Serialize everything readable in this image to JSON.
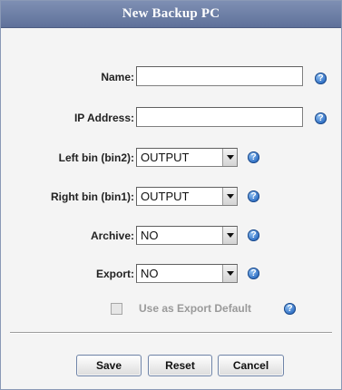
{
  "dialog": {
    "title": "New Backup PC"
  },
  "form": {
    "name": {
      "label": "Name:",
      "value": ""
    },
    "ip_address": {
      "label": "IP Address:",
      "value": ""
    },
    "left_bin": {
      "label": "Left bin (bin2):",
      "value": "OUTPUT"
    },
    "right_bin": {
      "label": "Right bin (bin1):",
      "value": "OUTPUT"
    },
    "archive": {
      "label": "Archive:",
      "value": "NO"
    },
    "export": {
      "label": "Export:",
      "value": "NO"
    },
    "export_default": {
      "label": "Use as Export Default",
      "checked": false,
      "disabled": true
    }
  },
  "help_glyph": "?",
  "icons": {
    "help": "help-icon",
    "dropdown": "chevron-down-icon"
  },
  "buttons": {
    "save": "Save",
    "reset": "Reset",
    "cancel": "Cancel"
  },
  "colors": {
    "titlebar": "#6a7ca4",
    "help_icon": "#2f6fc4",
    "background": "#f4f4f4"
  }
}
